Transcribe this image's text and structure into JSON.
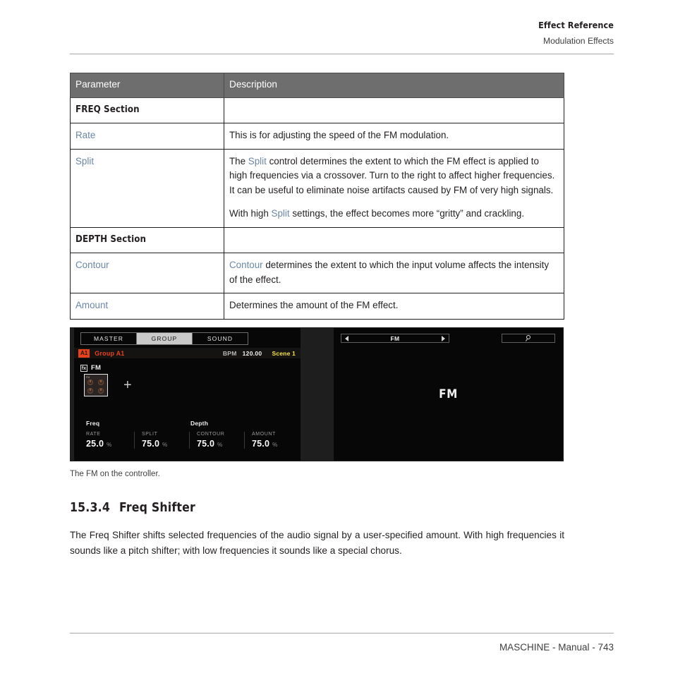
{
  "header": {
    "title": "Effect Reference",
    "subtitle": "Modulation Effects"
  },
  "table": {
    "columns": [
      "Parameter",
      "Description"
    ],
    "rows": [
      {
        "type": "section",
        "parameter": "FREQ Section",
        "description": ""
      },
      {
        "type": "param",
        "parameter": "Rate",
        "paragraphs": [
          [
            {
              "t": "This is for adjusting the speed of the FM modulation.",
              "hl": false
            }
          ]
        ]
      },
      {
        "type": "param",
        "parameter": "Split",
        "paragraphs": [
          [
            {
              "t": "The ",
              "hl": false
            },
            {
              "t": "Split",
              "hl": true
            },
            {
              "t": " control determines the extent to which the FM effect is applied to high frequencies via a crossover. Turn to the right to affect higher frequencies. It can be useful to eliminate noise artifacts caused by FM of very high signals.",
              "hl": false
            }
          ],
          [
            {
              "t": "With high ",
              "hl": false
            },
            {
              "t": "Split",
              "hl": true
            },
            {
              "t": " settings, the effect becomes more “gritty” and crackling.",
              "hl": false
            }
          ]
        ]
      },
      {
        "type": "section",
        "parameter": "DEPTH Section",
        "description": ""
      },
      {
        "type": "param",
        "parameter": "Contour",
        "paragraphs": [
          [
            {
              "t": "Contour",
              "hl": true
            },
            {
              "t": " determines the extent to which the input volume affects the intensity of the effect.",
              "hl": false
            }
          ]
        ]
      },
      {
        "type": "param",
        "parameter": "Amount",
        "paragraphs": [
          [
            {
              "t": "Determines the amount of the FM effect.",
              "hl": false
            }
          ]
        ]
      }
    ]
  },
  "controller": {
    "left_display": {
      "tabs": [
        {
          "label": "MASTER",
          "active": false
        },
        {
          "label": "GROUP",
          "active": true
        },
        {
          "label": "SOUND",
          "active": false
        }
      ],
      "group_badge": "A1",
      "group_name": "Group A1",
      "bpm_label": "BPM",
      "bpm_value": "120.00",
      "scene_value": "Scene 1",
      "slot_chip": "fx",
      "slot_name": "FM",
      "plugin_thumb_title": "FM",
      "add_icon": "+",
      "sections": [
        {
          "label": "Freq"
        },
        {
          "label": "Depth"
        }
      ],
      "parameters": [
        {
          "label": "RATE",
          "value": "25.0",
          "unit": "%"
        },
        {
          "label": "SPLIT",
          "value": "75.0",
          "unit": "%"
        },
        {
          "label": "CONTOUR",
          "value": "75.0",
          "unit": "%"
        },
        {
          "label": "AMOUNT",
          "value": "75.0",
          "unit": "%"
        }
      ]
    },
    "right_display": {
      "browse_label": "FM",
      "prev_icon": "triangle-left-icon",
      "next_icon": "triangle-right-icon",
      "search_icon": "magnifier-icon",
      "main_label": "FM"
    }
  },
  "caption": "The FM on the controller.",
  "section_heading": {
    "number": "15.3.4",
    "title": "Freq Shifter"
  },
  "body": "The Freq Shifter shifts selected frequencies of the audio signal by a user-specified amount. With high frequencies it sounds like a pitch shifter; with low frequencies it sounds like a special chorus.",
  "footer": "MASCHINE - Manual - 743",
  "colors": {
    "accent_blue": "#6a86a8",
    "table_header_bg": "#6e6e6e",
    "group_orange": "#e8401a",
    "scene_yellow": "#f5e53c",
    "display_black": "#070707"
  }
}
